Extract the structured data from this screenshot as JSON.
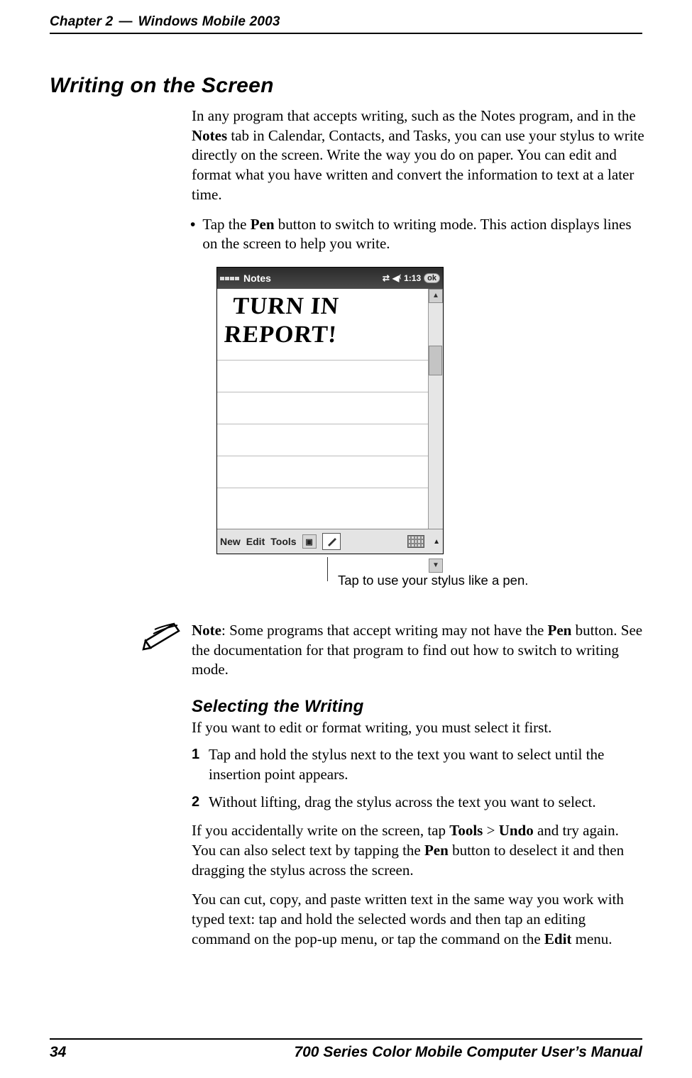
{
  "header": {
    "chapter": "Chapter 2",
    "title": "Windows Mobile 2003"
  },
  "h1": "Writing on the Screen",
  "intro": {
    "p1a": "In any program that accepts writing, such as the Notes program, and in the ",
    "p1_bold": "Notes",
    "p1b": " tab in Calendar, Contacts, and Tasks, you can use your stylus to write directly on the screen. Write the way you do on paper. You can edit and format what you have written and convert the information to text at a later time."
  },
  "bullet": {
    "pre": "Tap the ",
    "bold": "Pen",
    "post": " button to switch to writing mode. This action displays lines on the screen to help you write."
  },
  "screenshot": {
    "title": "Notes",
    "time": "1:13",
    "ok": "ok",
    "handwriting_line1": "TURN IN",
    "handwriting_line2": "REPORT!",
    "menu_new": "New",
    "menu_edit": "Edit",
    "menu_tools": "Tools",
    "callout": "Tap to use your stylus like a pen."
  },
  "note": {
    "pre": "Note",
    "mid1": ": Some programs that accept writing may not have the ",
    "bold": "Pen",
    "mid2": " button. See the documentation for that program to find out how to switch to writing mode."
  },
  "h2": "Selecting the Writing",
  "sel_intro": "If you want to edit or format writing, you must select it first.",
  "step1": "Tap and hold the stylus next to the text you want to select until the insertion point appears.",
  "step2": "Without lifting, drag the stylus across the text you want to select.",
  "p_after_steps": {
    "a": "If you accidentally write on the screen, tap ",
    "b1": "Tools",
    "gt": " > ",
    "b2": "Undo",
    "c": " and try again. You can also select text by tapping the ",
    "b3": "Pen",
    "d": " button to deselect it and then dragging the stylus across the screen."
  },
  "p_cut_copy": {
    "a": "You can cut, copy, and paste written text in the same way you work with typed text: tap and hold the selected words and then tap an editing command on the pop-up menu, or tap the command on the ",
    "b": "Edit",
    "c": " menu."
  },
  "footer": {
    "page": "34",
    "manual": "700 Series Color Mobile Computer User’s Manual"
  }
}
